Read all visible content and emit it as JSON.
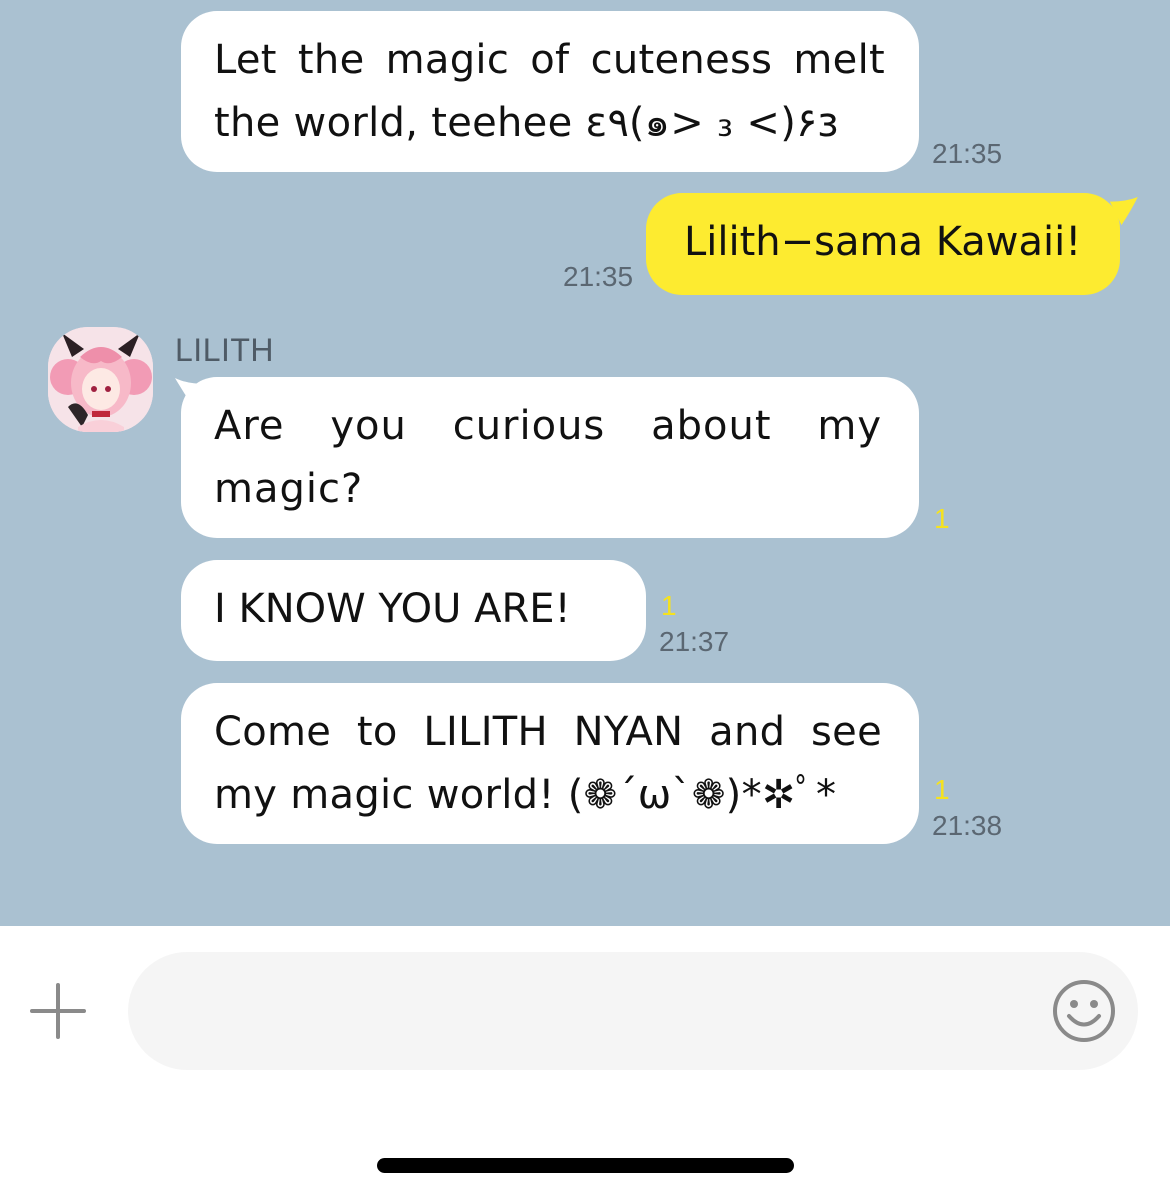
{
  "chat": {
    "messages": [
      {
        "direction": "in",
        "text": "Let the magic of cuteness melt the world, teehee ε٩(๑> ₃ <)۶з",
        "time": "21:35",
        "unread": ""
      },
      {
        "direction": "out",
        "text": "Lilith−sama Kawaii!",
        "time": "21:35",
        "unread": ""
      },
      {
        "direction": "in",
        "sender": "LILITH",
        "text": "Are you curious about my magic?",
        "time": "",
        "unread": "1"
      },
      {
        "direction": "in",
        "text": "I KNOW YOU ARE!",
        "time": "21:37",
        "unread": "1"
      },
      {
        "direction": "in",
        "text": "Come to LILITH NYAN and see my magic world! (❁´ω`❁)*✲ﾟ*",
        "time": "21:38",
        "unread": "1"
      }
    ]
  },
  "composer": {
    "placeholder": "",
    "plus_icon": "plus-icon",
    "emoji_icon": "smiley-icon"
  },
  "colors": {
    "chat_background": "#aac1d1",
    "incoming_bubble": "#ffffff",
    "outgoing_bubble": "#fdeb30",
    "unread_count": "#f5e21f"
  }
}
